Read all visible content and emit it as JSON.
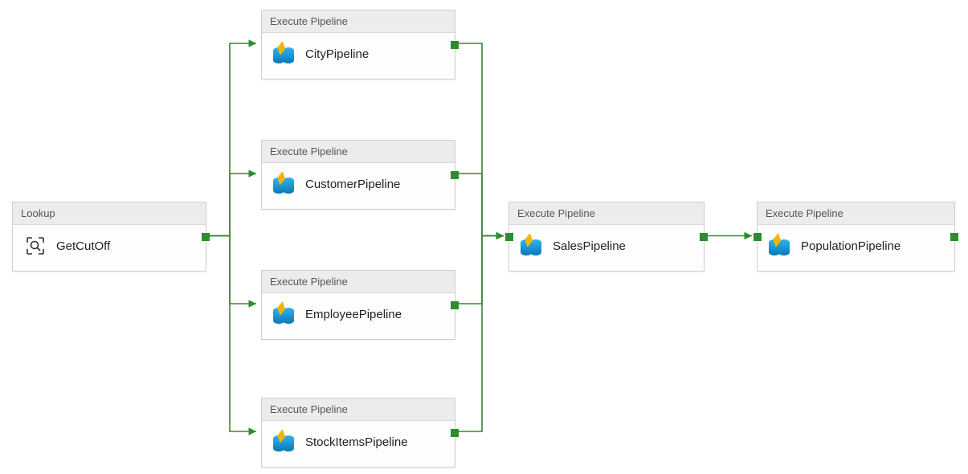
{
  "activities": [
    {
      "type": "Lookup",
      "name": "GetCutOff",
      "icon": "lookup-icon"
    },
    {
      "type": "Execute Pipeline",
      "name": "CityPipeline",
      "icon": "pipeline-icon"
    },
    {
      "type": "Execute Pipeline",
      "name": "CustomerPipeline",
      "icon": "pipeline-icon"
    },
    {
      "type": "Execute Pipeline",
      "name": "EmployeePipeline",
      "icon": "pipeline-icon"
    },
    {
      "type": "Execute Pipeline",
      "name": "StockItemsPipeline",
      "icon": "pipeline-icon"
    },
    {
      "type": "Execute Pipeline",
      "name": "SalesPipeline",
      "icon": "pipeline-icon"
    },
    {
      "type": "Execute Pipeline",
      "name": "PopulationPipeline",
      "icon": "pipeline-icon"
    }
  ],
  "connections": [
    {
      "from": "GetCutOff",
      "to": "CityPipeline",
      "condition": "success"
    },
    {
      "from": "GetCutOff",
      "to": "CustomerPipeline",
      "condition": "success"
    },
    {
      "from": "GetCutOff",
      "to": "EmployeePipeline",
      "condition": "success"
    },
    {
      "from": "GetCutOff",
      "to": "StockItemsPipeline",
      "condition": "success"
    },
    {
      "from": "CityPipeline",
      "to": "SalesPipeline",
      "condition": "success"
    },
    {
      "from": "CustomerPipeline",
      "to": "SalesPipeline",
      "condition": "success"
    },
    {
      "from": "EmployeePipeline",
      "to": "SalesPipeline",
      "condition": "success"
    },
    {
      "from": "StockItemsPipeline",
      "to": "SalesPipeline",
      "condition": "success"
    },
    {
      "from": "SalesPipeline",
      "to": "PopulationPipeline",
      "condition": "success"
    }
  ],
  "colors": {
    "connector": "#2e8b2e",
    "pipelineIcon": "#0a8fd6",
    "bolt": "#f4b400"
  }
}
